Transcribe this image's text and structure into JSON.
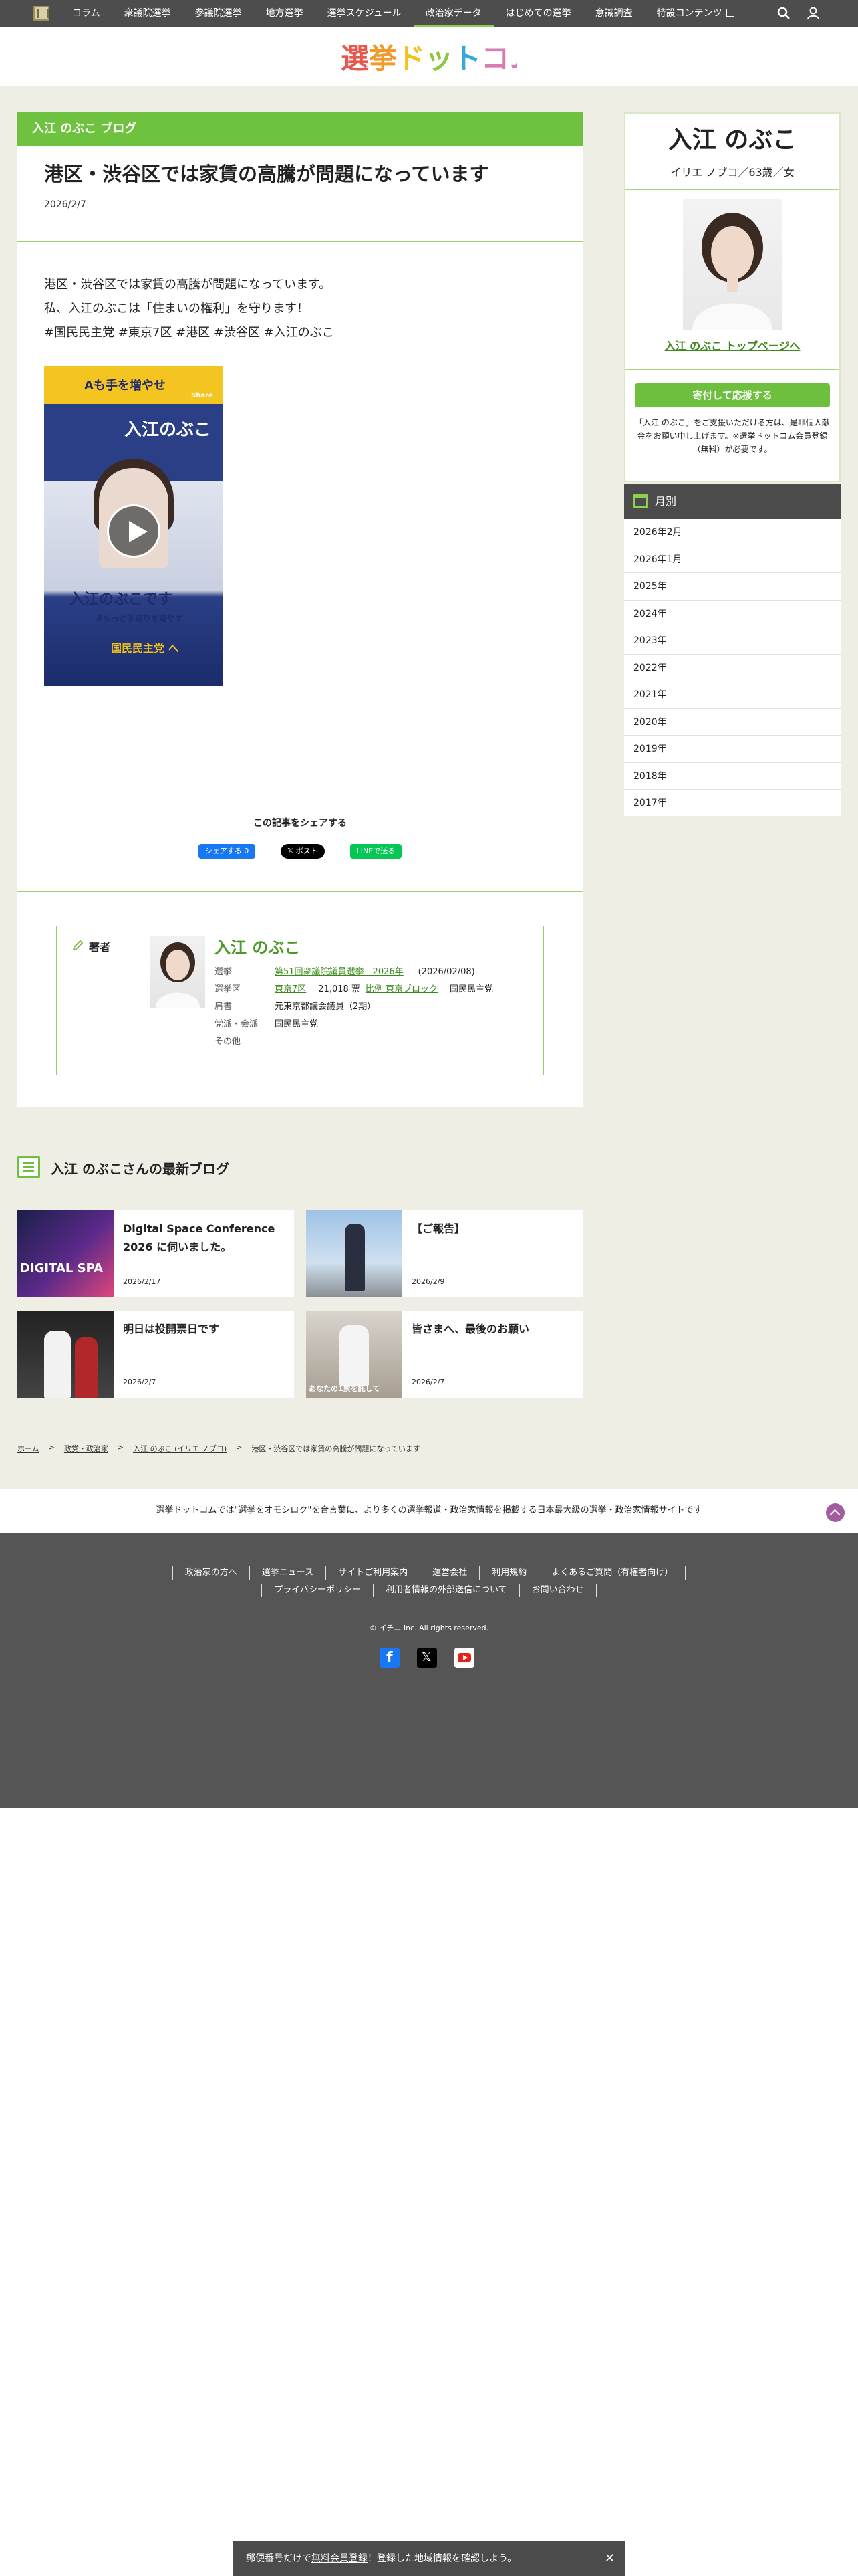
{
  "nav": {
    "items": [
      "コラム",
      "衆議院選挙",
      "参議院選挙",
      "地方選挙",
      "選挙スケジュール",
      "政治家データ",
      "はじめての選挙",
      "意識調査",
      "特設コンテンツ"
    ],
    "active_index": 5
  },
  "logo": {
    "text": "選挙ドットコム"
  },
  "article": {
    "blog_label": "入江 のぶこ ブログ",
    "title": "港区・渋谷区では家賃の高騰が問題になっています",
    "date": "2026/2/7",
    "body_lines": [
      "港区・渋谷区では家賃の高騰が問題になっています。",
      "私、入江のぶこは「住まいの権利」を守ります！",
      "#国民民主党 #東京7区 #港区 #渋谷区 #入江のぶこ"
    ],
    "video": {
      "banner_text": "Aも手を増やせ",
      "share_label": "Share",
      "name_text": "入江のぶこ",
      "mid_text": "入江のぶこです",
      "tagline": "#もっと手取りを増やす",
      "party_text": "国民民主党 へ"
    },
    "share_title": "この記事をシェアする",
    "share_buttons": [
      "シェアする 0",
      "𝕏 ポスト",
      "LINEで送る"
    ]
  },
  "author": {
    "label": "著者",
    "name": "入江 のぶこ",
    "rows": [
      {
        "k": "選挙",
        "v": "第51回衆議院議員選挙　2026年",
        "extra": "(2026/02/08)"
      },
      {
        "k": "選挙区",
        "v": "東京7区",
        "extra": "21,018 票",
        "v2": "比例 東京ブロック",
        "extra2": "国民民主党"
      },
      {
        "k": "肩書",
        "v": "元東京都議会議員（2期）"
      },
      {
        "k": "党派・会派",
        "v": "国民民主党"
      },
      {
        "k": "その他",
        "v": ""
      }
    ]
  },
  "sidebar": {
    "name": "入江 のぶこ",
    "kana": "イリエ ノブコ／63歳／女",
    "top_link": "入江 のぶこ トップページへ",
    "donate_button": "寄付して応援する",
    "donate_note": "「入江 のぶこ」をご支援いただける方は、是非個人献金をお願い申し上げます。※選挙ドットコム会員登録（無料）が必要です。",
    "month_title": "月別",
    "months": [
      "2026年2月",
      "2026年1月",
      "2025年",
      "2024年",
      "2023年",
      "2022年",
      "2021年",
      "2020年",
      "2019年",
      "2018年",
      "2017年"
    ]
  },
  "latest": {
    "title": "入江 のぶこさんの最新ブログ",
    "cards": [
      {
        "title": "Digital Space Conference 2026 に伺いました。",
        "date": "2026/2/17",
        "thumb_text": "DIGITAL SPA"
      },
      {
        "title": "【ご報告】",
        "date": "2026/2/9",
        "thumb_text": ""
      },
      {
        "title": "明日は投開票日です",
        "date": "2026/2/7",
        "thumb_text": ""
      },
      {
        "title": "皆さまへ、最後のお願い",
        "date": "2026/2/7",
        "thumb_text": "あなたの1票を託して"
      }
    ]
  },
  "breadcrumb": [
    "ホーム",
    "政党・政治家",
    "入江 のぶこ (イリエ ノブコ)",
    "港区・渋谷区では家賃の高騰が問題になっています"
  ],
  "tagline": "選挙ドットコムでは\"選挙をオモシロク\"を合言葉に、より多くの選挙報道・政治家情報を掲載する日本最大級の選挙・政治家情報サイトです",
  "footer": {
    "row1": [
      "政治家の方へ",
      "選挙ニュース",
      "サイトご利用案内",
      "運営会社",
      "利用規約",
      "よくあるご質問（有権者向け）"
    ],
    "row2": [
      "プライバシーポリシー",
      "利用者情報の外部送信について",
      "お問い合わせ"
    ],
    "copyright": "© イチニ Inc. All rights reserved."
  },
  "banner": {
    "pre": "郵便番号だけで",
    "link": "無料会員登録",
    "post": "！登録した地域情報を確認しよう。",
    "close": "✕"
  },
  "colors": {
    "accent_green": "#6ec23f",
    "footer_gray": "#555555",
    "author_green": "#4b9a27"
  }
}
